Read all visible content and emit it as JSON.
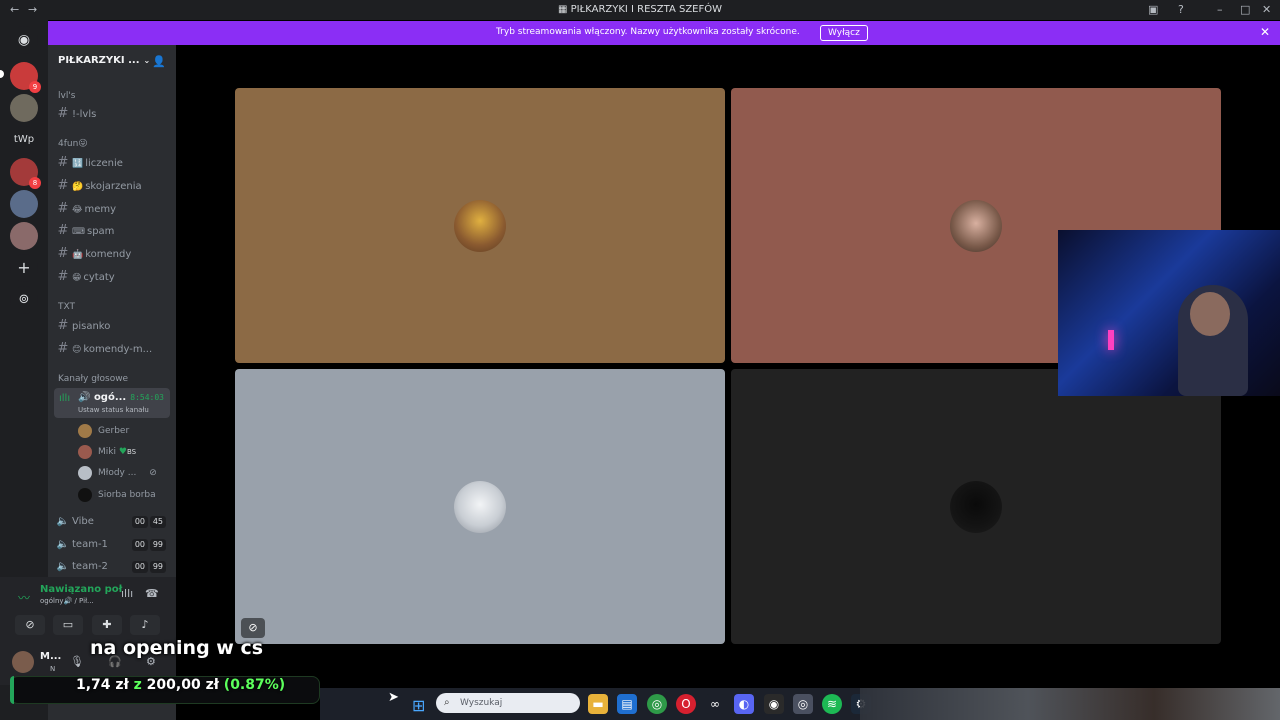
{
  "window": {
    "title": "PIŁKARZYKI I RESZTA SZEFÓW"
  },
  "banner": {
    "text": "Tryb streamowania włączony. Nazwy użytkownika zostały skrócone.",
    "button": "Wyłącz"
  },
  "rail": {
    "servers": [
      {
        "label": "",
        "badge": "9"
      },
      {
        "label": "",
        "badge": ""
      },
      {
        "label": "tWp",
        "badge": ""
      },
      {
        "label": "",
        "badge": "8"
      },
      {
        "label": "",
        "badge": ""
      },
      {
        "label": "",
        "badge": ""
      }
    ]
  },
  "sidebar": {
    "server_name": "PIŁKARZYKI ...",
    "categories": {
      "lvls": "lvl's",
      "fun": "4fun😜",
      "txt": "TXT",
      "voice": "Kanały głosowe"
    },
    "channels": {
      "lvls": "!-lvls",
      "liczenie": "liczenie",
      "skojarzenia": "skojarzenia",
      "memy": "memy",
      "spam": "spam",
      "komendy": "komendy",
      "cytaty": "cytaty",
      "pisanko": "pisanko",
      "komendy_m": "komendy-m..."
    },
    "emojis": {
      "liczenie": "🔢",
      "skojarzenia": "🤔",
      "memy": "😂",
      "spam": "⌨",
      "komendy": "🤖",
      "cytaty": "😁",
      "komendy_m": "😊"
    },
    "active_voice": {
      "name": "ogó...",
      "timer": "8:54:03",
      "status": "Ustaw status kanału"
    },
    "voice_users": [
      "Gerber",
      "Miki",
      "Młody ...",
      "Siorba borba"
    ],
    "miki_tag": "BS",
    "voice_channels": [
      {
        "name": "Vibe",
        "count_a": "00",
        "count_b": "45"
      },
      {
        "name": "team-1",
        "count_a": "00",
        "count_b": "99"
      },
      {
        "name": "team-2",
        "count_a": "00",
        "count_b": "99"
      }
    ]
  },
  "voice_panel": {
    "connected": "Nawiązano poł",
    "location": "ogólny🔊 / Pił..."
  },
  "user_panel": {
    "name": "M...",
    "status": "N"
  },
  "tiles": {
    "colors": [
      "#8c6a45",
      "#915a4e",
      "#99a1ab",
      "#222222"
    ]
  },
  "overlay": {
    "caption": "na opening w cs",
    "donation_current": "1,74 zł",
    "donation_sep": "z",
    "donation_goal": "200,00 zł",
    "donation_pct": "(0.87%)",
    "donation_progress": 0.0087
  },
  "taskbar": {
    "search_placeholder": "Wyszukaj"
  }
}
